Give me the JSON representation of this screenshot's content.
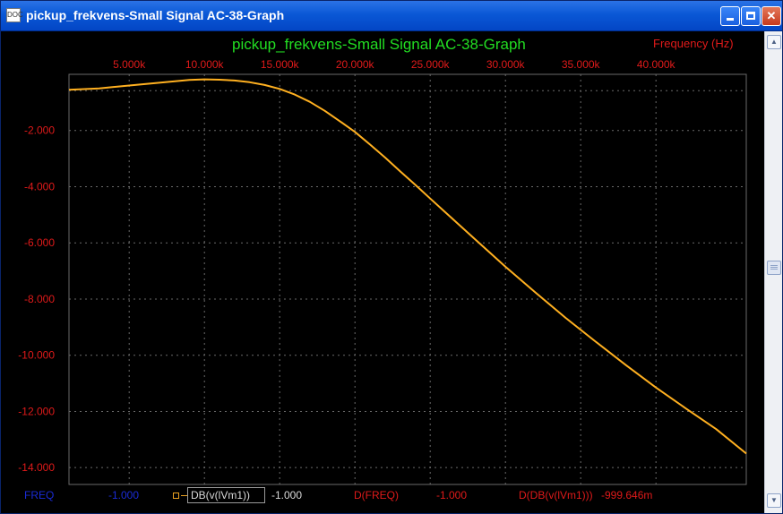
{
  "window": {
    "title": "pickup_frekvens-Small Signal AC-38-Graph",
    "icon": "analysis-window-icon",
    "icon_text": "DOC"
  },
  "graph": {
    "title": "pickup_frekvens-Small Signal AC-38-Graph",
    "xaxis_label": "Frequency   (Hz)"
  },
  "legend": {
    "x_var": "FREQ",
    "x_value": "-1.000",
    "trace_name": "DB(v(lVm1))",
    "trace_value": "-1.000",
    "dx_var": "D(FREQ)",
    "dx_value": "-1.000",
    "dy_var": "D(DB(v(lVm1)))",
    "dy_value": "-999.646m"
  },
  "colors": {
    "background": "#000000",
    "title": "#22dd22",
    "axis_text": "#e01a1a",
    "curve": "#ffb020",
    "grid": "#6a6a6a",
    "legend_blue": "#1a2bd6"
  },
  "chart_data": {
    "type": "line",
    "title": "pickup_frekvens-Small Signal AC-38-Graph",
    "xlabel": "Frequency   (Hz)",
    "ylabel": "",
    "xlim": [
      1000,
      46000
    ],
    "ylim": [
      -14.6,
      0
    ],
    "x_ticks": [
      5000,
      10000,
      15000,
      20000,
      25000,
      30000,
      35000,
      40000
    ],
    "x_tick_labels": [
      "5.000k",
      "10.000k",
      "15.000k",
      "20.000k",
      "25.000k",
      "30.000k",
      "35.000k",
      "40.000k"
    ],
    "y_ticks": [
      -2,
      -4,
      -6,
      -8,
      -10,
      -12,
      -14
    ],
    "y_tick_labels": [
      "-2.000",
      "-4.000",
      "-6.000",
      "-8.000",
      "-10.000",
      "-12.000",
      "-14.000"
    ],
    "grid": true,
    "series": [
      {
        "name": "DB(v(lVm1))",
        "x": [
          1000,
          3000,
          5000,
          7000,
          9000,
          10000,
          11000,
          12000,
          13000,
          14000,
          15000,
          16000,
          17000,
          18000,
          19000,
          20000,
          21000,
          22000,
          23000,
          24000,
          25000,
          26000,
          28000,
          30000,
          32000,
          34000,
          36000,
          38000,
          40000,
          42000,
          44000,
          46000
        ],
        "y": [
          -0.55,
          -0.5,
          -0.4,
          -0.3,
          -0.2,
          -0.18,
          -0.19,
          -0.22,
          -0.28,
          -0.38,
          -0.52,
          -0.72,
          -0.98,
          -1.3,
          -1.67,
          -2.05,
          -2.5,
          -2.96,
          -3.45,
          -3.93,
          -4.42,
          -4.91,
          -5.88,
          -6.85,
          -7.77,
          -8.67,
          -9.52,
          -10.35,
          -11.15,
          -11.9,
          -12.63,
          -13.5
        ]
      }
    ]
  }
}
